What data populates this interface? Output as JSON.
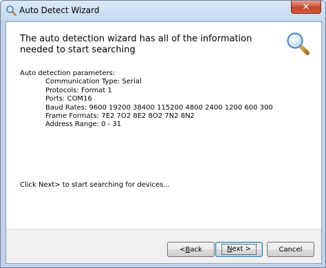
{
  "window": {
    "title": "Auto Detect Wizard",
    "close_label": "✕"
  },
  "header": {
    "text": "The auto detection wizard has all of the information needed to start searching"
  },
  "params": {
    "title": "Auto detection parameters:",
    "lines": [
      "Communication Type: Serial",
      "Protocols: Format 1",
      "Ports: COM16",
      "Baud Rates: 9600 19200 38400 115200 4800 2400 1200 600 300",
      "Frame Formats: 7E2 7O2 8E2 8O2 7N2 8N2",
      "Address Range: 0 - 31"
    ]
  },
  "instruction": "Click Next> to start searching for devices...",
  "buttons": {
    "back_key": "B",
    "back_rest": "ack",
    "back_prefix": "< ",
    "next_key": "N",
    "next_rest": "ext >",
    "cancel": "Cancel"
  },
  "colors": {
    "titlebar": "#c7daf1",
    "close": "#c9462c",
    "footer": "#f0f0f0"
  }
}
